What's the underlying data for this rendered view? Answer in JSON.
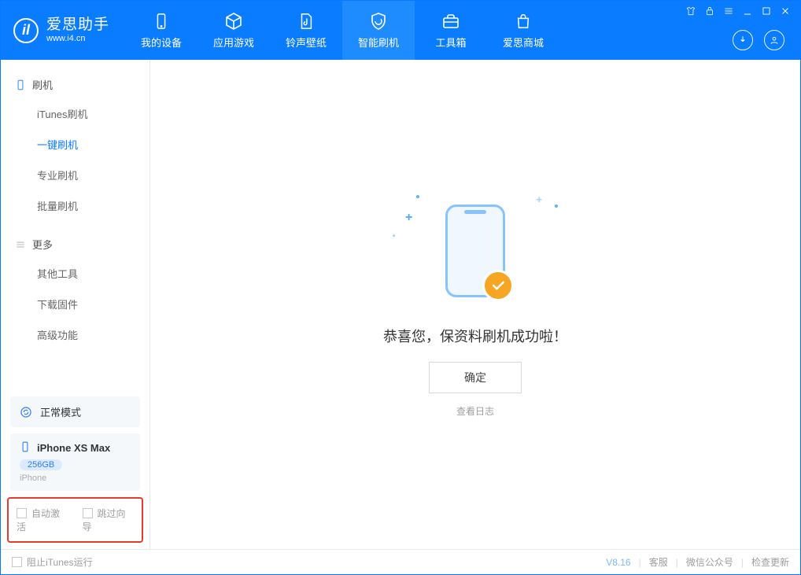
{
  "app": {
    "name": "爱思助手",
    "site": "www.i4.cn"
  },
  "tabs": [
    {
      "label": "我的设备"
    },
    {
      "label": "应用游戏"
    },
    {
      "label": "铃声壁纸"
    },
    {
      "label": "智能刷机"
    },
    {
      "label": "工具箱"
    },
    {
      "label": "爱思商城"
    }
  ],
  "sidebar": {
    "group1_title": "刷机",
    "group1": [
      {
        "label": "iTunes刷机"
      },
      {
        "label": "一键刷机"
      },
      {
        "label": "专业刷机"
      },
      {
        "label": "批量刷机"
      }
    ],
    "group2_title": "更多",
    "group2": [
      {
        "label": "其他工具"
      },
      {
        "label": "下载固件"
      },
      {
        "label": "高级功能"
      }
    ],
    "mode": "正常模式",
    "device": {
      "name": "iPhone XS Max",
      "storage": "256GB",
      "type": "iPhone"
    },
    "opts": {
      "auto_activate": "自动激活",
      "skip_guide": "跳过向导"
    }
  },
  "main": {
    "success": "恭喜您，保资料刷机成功啦！",
    "ok": "确定",
    "view_log": "查看日志"
  },
  "footer": {
    "block_itunes": "阻止iTunes运行",
    "version": "V8.16",
    "support": "客服",
    "wechat": "微信公众号",
    "check_update": "检查更新"
  }
}
